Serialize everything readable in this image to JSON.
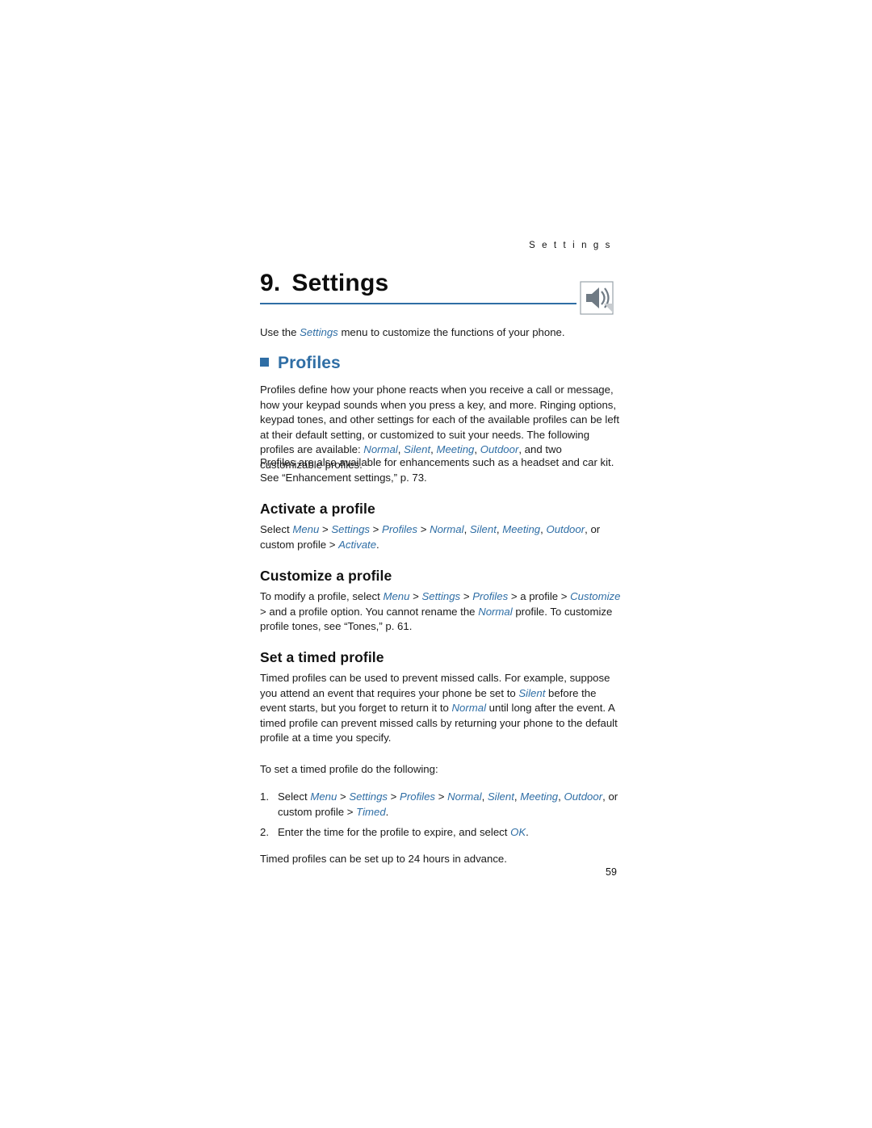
{
  "header": {
    "running_head": "S e t t i n g s"
  },
  "chapter": {
    "number": "9.",
    "title": "Settings",
    "icon": "speaker-icon"
  },
  "intro": {
    "before": "Use the ",
    "italic": "Settings",
    "after": " menu to customize the functions of your phone."
  },
  "sections": {
    "profiles_heading": "Profiles",
    "profiles_para1": {
      "lead": "Profiles define how your phone reacts when you receive a call or message, how your keypad sounds when you press a key, and more. Ringing options, keypad tones, and other settings for each of the available profiles can be left at their default setting, or customized to suit your needs. The following profiles are available: ",
      "items": [
        "Normal",
        "Silent",
        "Meeting",
        "Outdoor"
      ],
      "tail": ", and two customizable profiles."
    },
    "profiles_para2": "Profiles are also available for enhancements such as a headset and car kit. See “Enhancement settings,” p. 73.",
    "activate_heading": "Activate a profile",
    "activate_para": {
      "p1": "Select ",
      "menu": "Menu",
      "s1": " > ",
      "settings": "Settings",
      "s2": " > ",
      "profiles": "Profiles",
      "s3": " > ",
      "normal": "Normal",
      "c1": ", ",
      "silent": "Silent",
      "c2": ", ",
      "meeting": "Meeting",
      "c3": ", ",
      "outdoor": "Outdoor",
      "mid": ", or custom profile > ",
      "activate": "Activate",
      "end": "."
    },
    "customize_heading": "Customize a profile",
    "customize_para": {
      "p1": "To modify a profile, select ",
      "menu": "Menu",
      "s1": " > ",
      "settings": "Settings",
      "s2": " > ",
      "profiles": "Profiles",
      "s3": " > a profile > ",
      "customize": "Customize",
      "p2": " > and a profile option. You cannot rename the ",
      "normal": "Normal",
      "p3": " profile. To customize profile tones, see “Tones,” p. 61."
    },
    "timed_heading": "Set a timed profile",
    "timed_para1": {
      "p1": "Timed profiles can be used to prevent missed calls. For example, suppose you attend an event that requires your phone be set to ",
      "silent": "Silent",
      "p2": " before the event starts, but you forget to return it to ",
      "normal": "Normal",
      "p3": " until long after the event. A timed profile can prevent missed calls by returning your phone to the default profile at a time you specify."
    },
    "timed_intro": "To set a timed profile do the following:",
    "timed_steps": [
      {
        "num": "1.",
        "p1": "Select ",
        "menu": "Menu",
        "s1": " > ",
        "settings": "Settings",
        "s2": " > ",
        "profiles": "Profiles",
        "s3": " > ",
        "normal": "Normal",
        "c1": ", ",
        "silent": "Silent",
        "c2": ", ",
        "meeting": "Meeting",
        "c3": ", ",
        "outdoor": "Outdoor",
        "mid": ", or custom profile > ",
        "timed": "Timed",
        "end": "."
      },
      {
        "num": "2.",
        "p1": "Enter the time for the profile to expire, and select ",
        "ok": "OK",
        "end": "."
      }
    ],
    "timed_para2": "Timed profiles can be set up to 24 hours in advance."
  },
  "folio": "59",
  "colors": {
    "accent": "#2f6ea5",
    "text": "#1a1a1a"
  }
}
